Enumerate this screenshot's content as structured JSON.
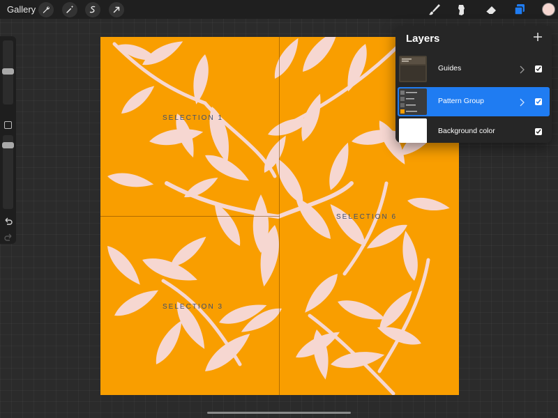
{
  "toolbar": {
    "gallery_label": "Gallery",
    "left_tools": [
      "wrench-icon",
      "magic-wand-icon",
      "selection-icon",
      "transform-arrow-icon"
    ],
    "right_tools": [
      "brush-icon",
      "smudge-icon",
      "eraser-icon",
      "layers-icon"
    ],
    "active_tool": "layers-icon",
    "accent_color": "#1f7cf2",
    "current_color": "#f5d6d0"
  },
  "canvas": {
    "background_color": "#f99e00",
    "leaf_color": "#f6d7d1",
    "selection_labels": [
      "SELECTION 1",
      "SELECTION 6",
      "SELECTION 3"
    ]
  },
  "layers_panel": {
    "title": "Layers",
    "layers": [
      {
        "name": "Guides",
        "visible": true,
        "selected": false,
        "is_group": true
      },
      {
        "name": "Pattern Group",
        "visible": true,
        "selected": true,
        "is_group": true
      },
      {
        "name": "Background color",
        "visible": true,
        "selected": false,
        "is_group": false,
        "color": "#ffffff"
      }
    ]
  }
}
